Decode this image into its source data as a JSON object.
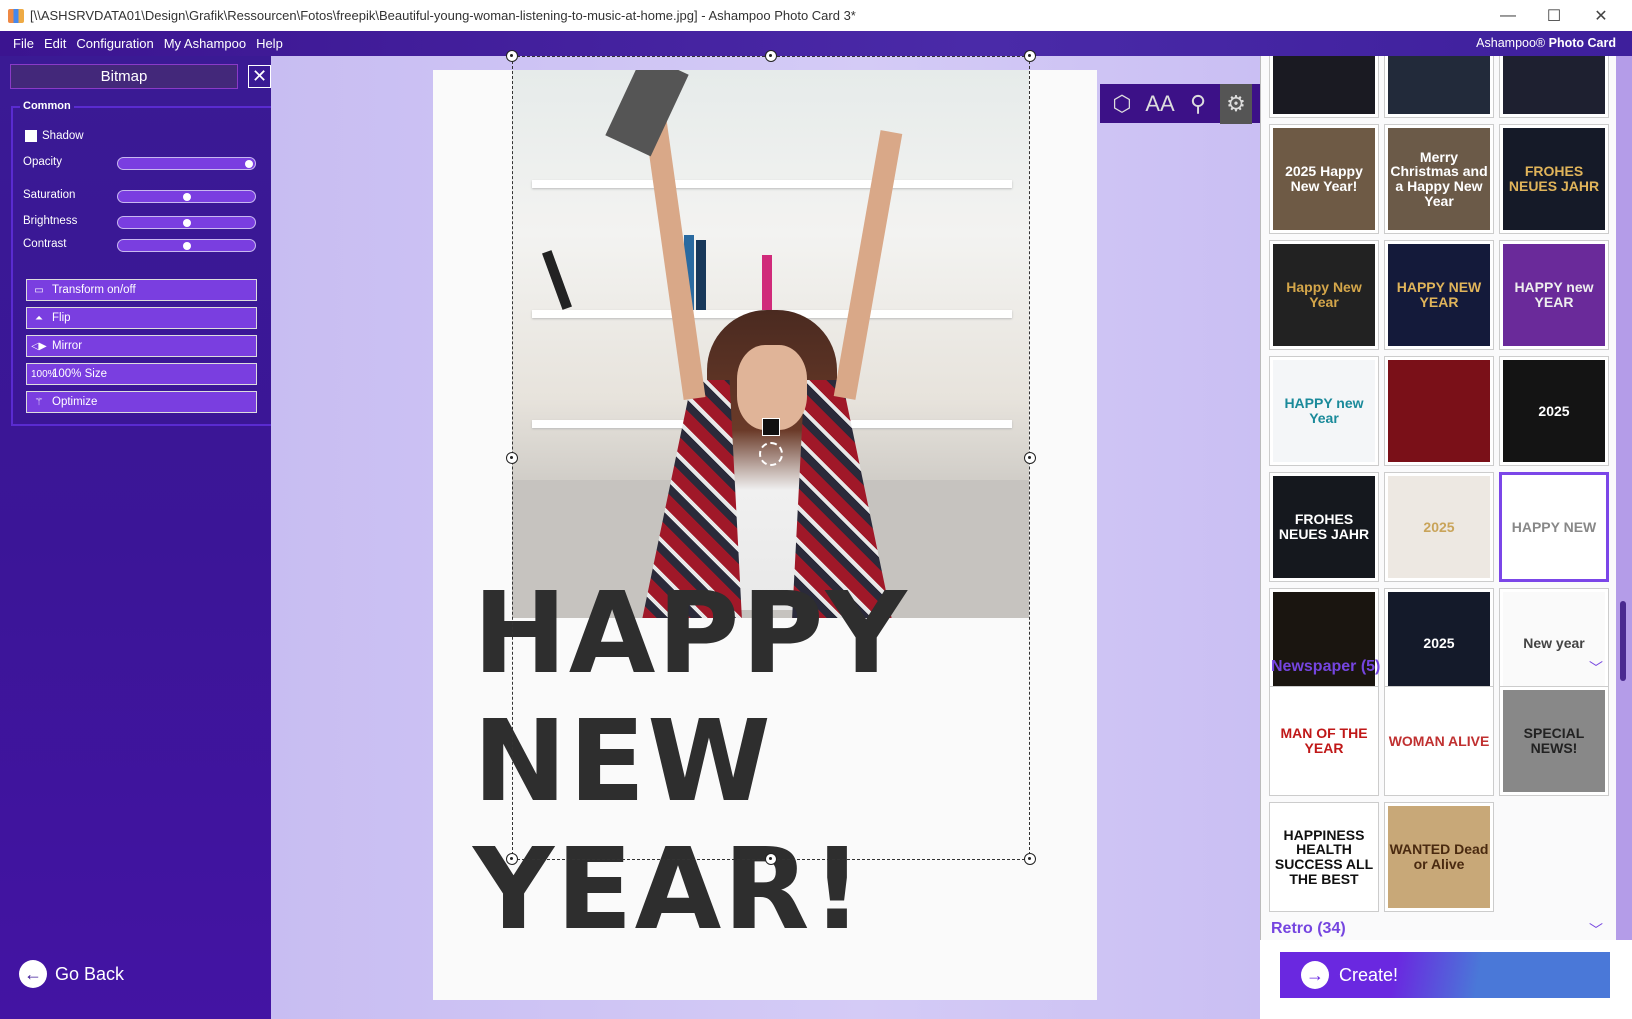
{
  "window": {
    "title": "[\\\\ASHSRVDATA01\\Design\\Grafik\\Ressourcen\\Fotos\\freepik\\Beautiful-young-woman-listening-to-music-at-home.jpg] - Ashampoo Photo Card 3*",
    "minimize": "—",
    "maximize": "☐",
    "close": "✕"
  },
  "menu": [
    "File",
    "Edit",
    "Configuration",
    "My Ashampoo",
    "Help"
  ],
  "brand": {
    "prefix": "Ashampoo®",
    "name": "Photo Card"
  },
  "sidebar": {
    "title": "Bitmap",
    "close": "✕",
    "group": "Common",
    "shadow_label": "Shadow",
    "shadow_checked": false,
    "sliders": [
      {
        "label": "Opacity",
        "value": 1.0
      },
      {
        "label": "Saturation",
        "value": 0.5
      },
      {
        "label": "Brightness",
        "value": 0.5
      },
      {
        "label": "Contrast",
        "value": 0.5
      }
    ],
    "buttons": [
      {
        "label": "Transform on/off",
        "icon": "▭"
      },
      {
        "label": "Flip",
        "icon": "⏶"
      },
      {
        "label": "Mirror",
        "icon": "◁▶"
      },
      {
        "label": "100% Size",
        "icon": "100%"
      },
      {
        "label": "Optimize",
        "icon": "⚚"
      }
    ],
    "go_back": "Go Back",
    "go_back_icon": "←"
  },
  "canvas": {
    "headline": [
      "HAPPY",
      "NEW",
      "YEAR!"
    ],
    "toolbar": [
      {
        "name": "shapes",
        "glyph": "⬡"
      },
      {
        "name": "text",
        "glyph": "AA"
      },
      {
        "name": "replace-image",
        "glyph": "⚲"
      },
      {
        "name": "settings",
        "glyph": "⚙"
      }
    ]
  },
  "templates": {
    "items": [
      {
        "text": "",
        "bg": "#1a1a22",
        "fg": "#d4a64a"
      },
      {
        "text": "",
        "bg": "#222a3a",
        "fg": "#fff"
      },
      {
        "text": "",
        "bg": "#1e2030",
        "fg": "#fff"
      },
      {
        "text": "2025 Happy New Year!",
        "bg": "#6e5a45",
        "fg": "#fff"
      },
      {
        "text": "Merry Christmas and a Happy New Year",
        "bg": "#6b5a48",
        "fg": "#fff"
      },
      {
        "text": "FROHES NEUES JAHR",
        "bg": "#151a28",
        "fg": "#e0b45a"
      },
      {
        "text": "Happy New Year",
        "bg": "#222",
        "fg": "#d4a64a"
      },
      {
        "text": "HAPPY NEW YEAR",
        "bg": "#141a3a",
        "fg": "#e0b45a"
      },
      {
        "text": "HAPPY new YEAR",
        "bg": "#6a2a9a",
        "fg": "#eee"
      },
      {
        "text": "HAPPY new Year",
        "bg": "#f4f6f8",
        "fg": "#1a8a9a"
      },
      {
        "text": "",
        "bg": "#7a1018",
        "fg": "#fff"
      },
      {
        "text": "2025",
        "bg": "#141414",
        "fg": "#fff"
      },
      {
        "text": "FROHES NEUES JAHR",
        "bg": "#15181e",
        "fg": "#fff"
      },
      {
        "text": "2025",
        "bg": "#ede8e2",
        "fg": "#c9a45a"
      },
      {
        "text": "HAPPY NEW",
        "bg": "#fff",
        "fg": "#888"
      },
      {
        "text": "",
        "bg": "#1a1510",
        "fg": "#d4a64a"
      },
      {
        "text": "2025",
        "bg": "#141a2a",
        "fg": "#fff"
      },
      {
        "text": "New year",
        "bg": "#fafafa",
        "fg": "#444"
      }
    ],
    "newspaper_header": "Newspaper (5)",
    "newspaper": [
      {
        "text": "MAN OF THE YEAR",
        "bg": "#fff",
        "fg": "#c01818"
      },
      {
        "text": "WOMAN ALIVE",
        "bg": "#fff",
        "fg": "#c03030"
      },
      {
        "text": "SPECIAL NEWS!",
        "bg": "#888",
        "fg": "#222"
      },
      {
        "text": "HAPPINESS HEALTH SUCCESS ALL THE BEST",
        "bg": "#fff",
        "fg": "#111"
      },
      {
        "text": "WANTED Dead or Alive",
        "bg": "#c8a878",
        "fg": "#4a2a10"
      }
    ],
    "retro_header": "Retro (34)",
    "chevron": "﹀"
  },
  "create": {
    "label": "Create!",
    "icon": "→"
  }
}
